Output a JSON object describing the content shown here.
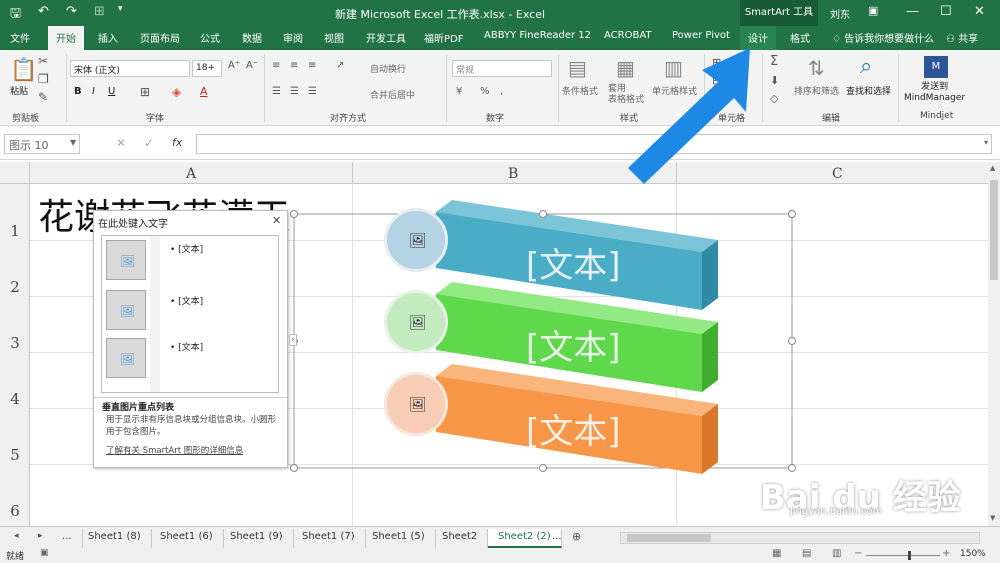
{
  "titlebar": {
    "save_icon": "save-icon",
    "undo_icon": "undo-icon",
    "redo_icon": "redo-icon",
    "title": "新建 Microsoft Excel 工作表.xlsx  -  Excel",
    "context_group": "SmartArt 工具",
    "user": "刘东"
  },
  "tabs": [
    "文件",
    "开始",
    "插入",
    "页面布局",
    "公式",
    "数据",
    "审阅",
    "视图",
    "开发工具",
    "福昕PDF",
    "ABBYY FineReader 12",
    "ACROBAT",
    "Power Pivot",
    "设计",
    "格式"
  ],
  "tell_me": "告诉我你想要做什么",
  "share": "共享",
  "ribbon": {
    "paste": "粘贴",
    "clipboard": "剪贴板",
    "font_name": "宋体 (正文)",
    "font_size": "18+",
    "font_group": "字体",
    "wrap": "自动换行",
    "merge": "合并后居中",
    "align_group": "对齐方式",
    "number_format": "常规",
    "number_group": "数字",
    "cond_format": "条件格式",
    "table_format": "套用\n表格格式",
    "cell_style": "单元格样式",
    "style_group": "样式",
    "cells_group": "单元格",
    "sort": "排序和筛选",
    "find": "查找和选择",
    "edit_group": "编辑",
    "mindmanager": "发送到\nMindManager",
    "mindjet": "Mindjet"
  },
  "formula": {
    "namebox": "图示 10",
    "fx": "fx"
  },
  "columns": [
    "A",
    "B",
    "C"
  ],
  "rows": [
    "1",
    "2",
    "3",
    "4",
    "5",
    "6"
  ],
  "cell_a1": "花谢花飞花满天",
  "pane": {
    "title": "在此处键入文字",
    "bullets": [
      "[文本]",
      "[文本]",
      "[文本]"
    ],
    "desc_title": "垂直图片重点列表",
    "desc": "用于显示非有序信息块或分组信息块。小圆形用于包含图片。",
    "link": "了解有关 SmartArt 图形的详细信息"
  },
  "smartart": {
    "items": [
      {
        "text": "[文本]",
        "color": "#4bacc6"
      },
      {
        "text": "[文本]",
        "color": "#5fd84b"
      },
      {
        "text": "[文本]",
        "color": "#f79646"
      }
    ]
  },
  "sheets": [
    "...",
    "Sheet1 (8)",
    "Sheet1 (6)",
    "Sheet1 (9)",
    "Sheet1 (7)",
    "Sheet1 (5)",
    "Sheet2",
    "Sheet2 (2)",
    "..."
  ],
  "status": {
    "ready": "就绪",
    "zoom": "150%"
  },
  "watermark": {
    "main": "Bai du 经验",
    "sub": "jingyan.baidu.com"
  }
}
